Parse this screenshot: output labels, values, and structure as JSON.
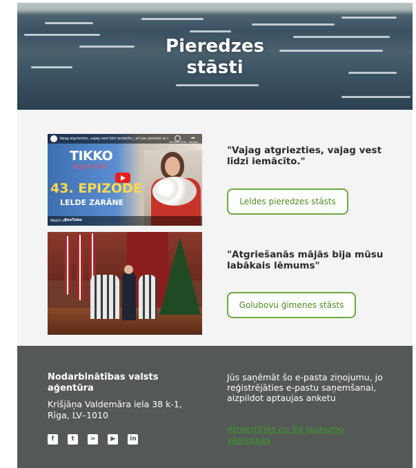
{
  "hero": {
    "title_line1": "Pieredzes",
    "title_line2": "stāsti"
  },
  "stories": [
    {
      "thumbnail": {
        "top_caption": "Vajag atgriezties, vajag vest līdzi iemācīto | arī par pieredzi ar Lati...",
        "side_caption_a": "Skatīties vēlāk",
        "side_caption_b": "Kopīgot",
        "brand": "TIKKO",
        "brand_sub": "Atgriezies",
        "episode": "43. EPIZODE",
        "guest": "LELDE ZARĀNE",
        "watch_on": "Watch on",
        "yt": "YouTube"
      },
      "quote": "\"Vajag atgriezties, vajag vest līdzi iemācīto.\"",
      "button_label": "Leldes pieredzes stāsts"
    },
    {
      "quote": "\"Atgriešanās mājās bija mūsu labākais lēmums\"",
      "button_label": "Golubovu ģimenes stāsts"
    }
  ],
  "footer": {
    "org_name": "Nodarbinātības valsts aģentūra",
    "address_line1": "Krišjāņa Valdemāra iela 38 k-1,",
    "address_line2": "Rīga, LV–1010",
    "socials": [
      {
        "label": "f",
        "icon": "facebook-icon"
      },
      {
        "label": "t",
        "icon": "twitter-icon"
      },
      {
        "label": "∞",
        "icon": "link-icon"
      },
      {
        "label": "▶",
        "icon": "youtube-icon"
      },
      {
        "label": "in",
        "icon": "linkedin-icon"
      }
    ],
    "notice": "Jūs saņēmāt šo e-pasta ziņojumu, jo reģistrējāties e-pastu saņemšanai, aizpildot aptaujas anketu",
    "unsubscribe": "Atrakstīties no šīs jaunumu vēstkopas"
  }
}
